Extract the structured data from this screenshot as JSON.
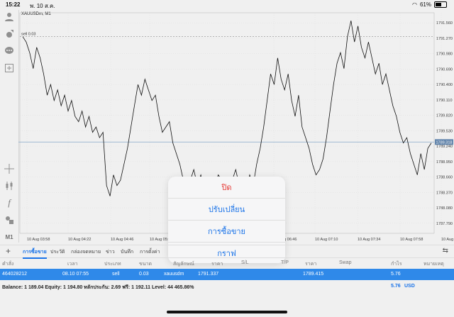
{
  "status_bar": {
    "time": "15:22",
    "date": "พ. 10 ส.ค.",
    "battery": "61%"
  },
  "chart": {
    "symbol": "XAUUSDm, M1",
    "sell_label": "sell 0.03",
    "current_price": "1789.318",
    "y_ticks": [
      "1791.560",
      "1791.270",
      "1790.980",
      "1790.690",
      "1790.400",
      "1790.110",
      "1789.820",
      "1789.530",
      "1789.240",
      "1788.950",
      "1788.660",
      "1788.370",
      "1788.080",
      "1787.790"
    ],
    "x_ticks": [
      "10 Aug 03:58",
      "10 Aug 04:22",
      "10 Aug 04:46",
      "10 Aug 05:10",
      "10 Aug 06:46",
      "10 Aug 07:10",
      "10 Aug 07:34",
      "10 Aug 07:58",
      "10 Aug 08:22"
    ],
    "sidebar_label": "M1"
  },
  "chart_data": {
    "type": "line",
    "title": "XAUUSDm, M1",
    "xlabel": "",
    "ylabel": "",
    "ylim": [
      1787.6,
      1791.75
    ],
    "x_labels": [
      "10 Aug 03:58",
      "10 Aug 04:22",
      "10 Aug 04:46",
      "10 Aug 05:10",
      "10 Aug 06:46",
      "10 Aug 07:10",
      "10 Aug 07:34",
      "10 Aug 07:58",
      "10 Aug 08:22"
    ],
    "series": [
      {
        "name": "",
        "values": [
          1791.3,
          1791.2,
          1791.0,
          1790.7,
          1791.1,
          1790.9,
          1790.6,
          1790.2,
          1790.4,
          1790.1,
          1790.3,
          1790.0,
          1790.2,
          1789.9,
          1790.1,
          1789.8,
          1789.7,
          1789.9,
          1789.6,
          1789.8,
          1789.5,
          1789.6,
          1789.4,
          1789.5,
          1788.5,
          1788.3,
          1788.7,
          1788.5,
          1788.6,
          1788.9,
          1789.2,
          1789.6,
          1790.0,
          1790.4,
          1790.2,
          1790.5,
          1790.3,
          1790.1,
          1790.2,
          1789.8,
          1789.5,
          1789.6,
          1789.7,
          1789.3,
          1789.1,
          1788.9,
          1788.6,
          1788.4,
          1788.6,
          1788.8,
          1788.5,
          1788.7,
          1788.4,
          1788.3,
          1788.6,
          1788.5,
          1788.7,
          1788.6,
          1788.4,
          1788.5,
          1788.6,
          1788.8,
          1788.5,
          1788.6,
          1788.4,
          1788.7,
          1788.5,
          1788.9,
          1789.2,
          1789.6,
          1790.1,
          1790.6,
          1790.4,
          1790.9,
          1790.5,
          1790.3,
          1790.6,
          1790.1,
          1789.8,
          1790.2,
          1789.6,
          1789.4,
          1789.2,
          1788.9,
          1788.7,
          1788.8,
          1789.0,
          1789.4,
          1789.9,
          1790.4,
          1790.8,
          1791.0,
          1790.7,
          1791.3,
          1791.6,
          1791.2,
          1791.5,
          1791.1,
          1790.9,
          1791.2,
          1790.9,
          1790.6,
          1790.8,
          1790.4,
          1790.6,
          1790.3,
          1790.0,
          1789.8,
          1789.5,
          1789.3,
          1789.4,
          1789.1,
          1788.9,
          1788.7,
          1789.1,
          1788.8,
          1789.2,
          1789.3
        ]
      }
    ],
    "price_line": 1789.318,
    "sell_line": 1791.3
  },
  "popup": {
    "close": "ปิด",
    "modify": "ปรับเปลี่ยน",
    "trade": "การซื้อขาย",
    "graph": "กราฟ"
  },
  "tabs": [
    "การซื้อขาย",
    "ประวัติ",
    "กล่องจดหมาย",
    "ข่าว",
    "บันทึก",
    "การตั้งค่า"
  ],
  "columns": {
    "order": "คำสั่ง",
    "time": "เวลา",
    "type": "ประเภท",
    "size": "ขนาด",
    "symbol": "สัญลักษณ์",
    "price": "ราคา",
    "sl": "S/L",
    "tp": "T/P",
    "price2": "ราคา",
    "swap": "Swap",
    "profit": "กำไร",
    "comment": "หมายเหตุ"
  },
  "position": {
    "order": "464028212",
    "time": "08.10 07:55",
    "type": "sell",
    "size": "0.03",
    "symbol": "xauusdm",
    "open_price": "1791.337",
    "current_price": "1789.415",
    "profit": "5.76"
  },
  "balance": {
    "text": "Balance: 1 189.04 Equity: 1 194.80 หลักประกัน: 2.69 ฟรี: 1 192.11 Level: 44 465.86%",
    "profit": "5.76",
    "currency": "USD"
  }
}
